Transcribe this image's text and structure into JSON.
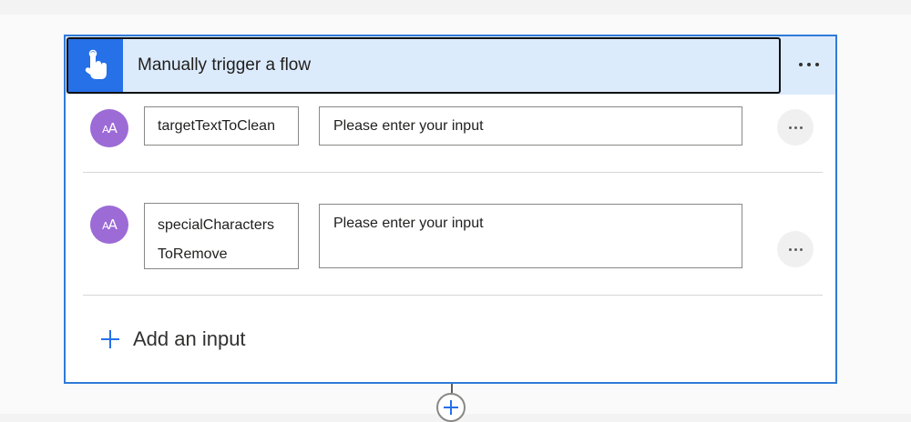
{
  "trigger": {
    "title": "Manually trigger a flow",
    "icon": "touch-hand-icon",
    "accent_color": "#2670e8",
    "header_bg": "#dcebfc"
  },
  "inputs": [
    {
      "type_icon": "text-type-icon",
      "name_lines": [
        "targetTextToClean"
      ],
      "value_placeholder": "Please enter your input"
    },
    {
      "type_icon": "text-type-icon",
      "name_lines": [
        "specialCharacters",
        "ToRemove"
      ],
      "value_placeholder": "Please enter your input"
    }
  ],
  "add_input": {
    "label": "Add an input"
  },
  "colors": {
    "card_border": "#2f7ad8",
    "avatar": "#9c6bd6"
  }
}
